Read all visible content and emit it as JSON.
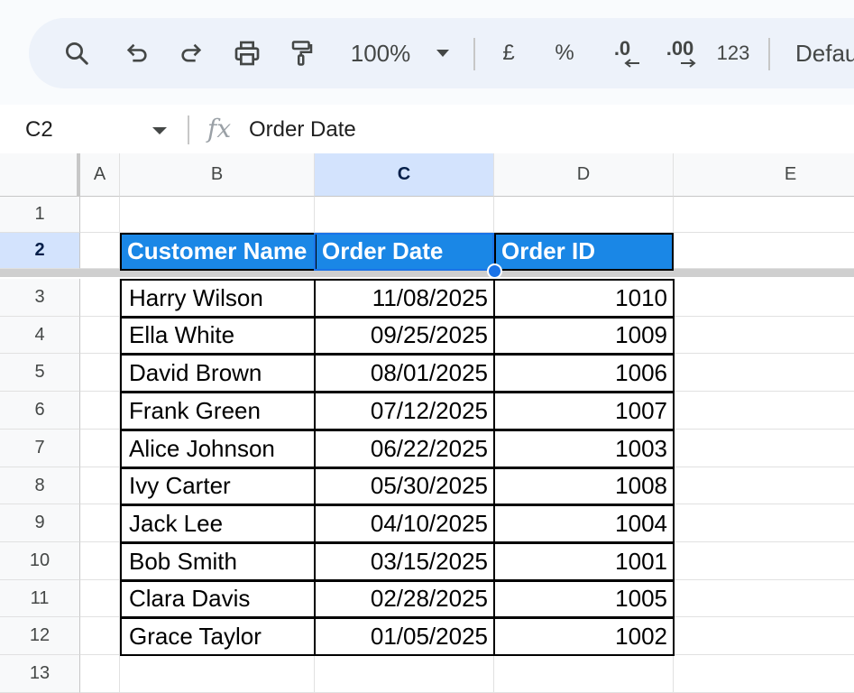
{
  "toolbar": {
    "zoom": "100%",
    "currency": "£",
    "percent": "%",
    "decrease_decimal": ".0",
    "increase_decimal": ".00",
    "number_format": "123",
    "font": "Defau"
  },
  "formula_bar": {
    "name_box": "C2",
    "fx": "fx",
    "content": "Order Date"
  },
  "grid": {
    "columns": [
      "A",
      "B",
      "C",
      "D",
      "E"
    ],
    "selected_column": "C",
    "selected_row": "2",
    "row_numbers": [
      "1",
      "2",
      "3",
      "4",
      "5",
      "6",
      "7",
      "8",
      "9",
      "10",
      "11",
      "12",
      "13"
    ],
    "table_headers": [
      "Customer Name",
      "Order Date",
      "Order ID"
    ],
    "rows": [
      {
        "name": "Harry Wilson",
        "date": "11/08/2025",
        "id": "1010"
      },
      {
        "name": "Ella White",
        "date": "09/25/2025",
        "id": "1009"
      },
      {
        "name": "David Brown",
        "date": "08/01/2025",
        "id": "1006"
      },
      {
        "name": "Frank Green",
        "date": "07/12/2025",
        "id": "1007"
      },
      {
        "name": "Alice Johnson",
        "date": "06/22/2025",
        "id": "1003"
      },
      {
        "name": "Ivy Carter",
        "date": "05/30/2025",
        "id": "1008"
      },
      {
        "name": "Jack Lee",
        "date": "04/10/2025",
        "id": "1004"
      },
      {
        "name": "Bob Smith",
        "date": "03/15/2025",
        "id": "1001"
      },
      {
        "name": "Clara Davis",
        "date": "02/28/2025",
        "id": "1005"
      },
      {
        "name": "Grace Taylor",
        "date": "01/05/2025",
        "id": "1002"
      }
    ]
  },
  "colors": {
    "header_fill": "#1a87e6",
    "selection": "#d3e3fd",
    "handle": "#1a73e8"
  }
}
